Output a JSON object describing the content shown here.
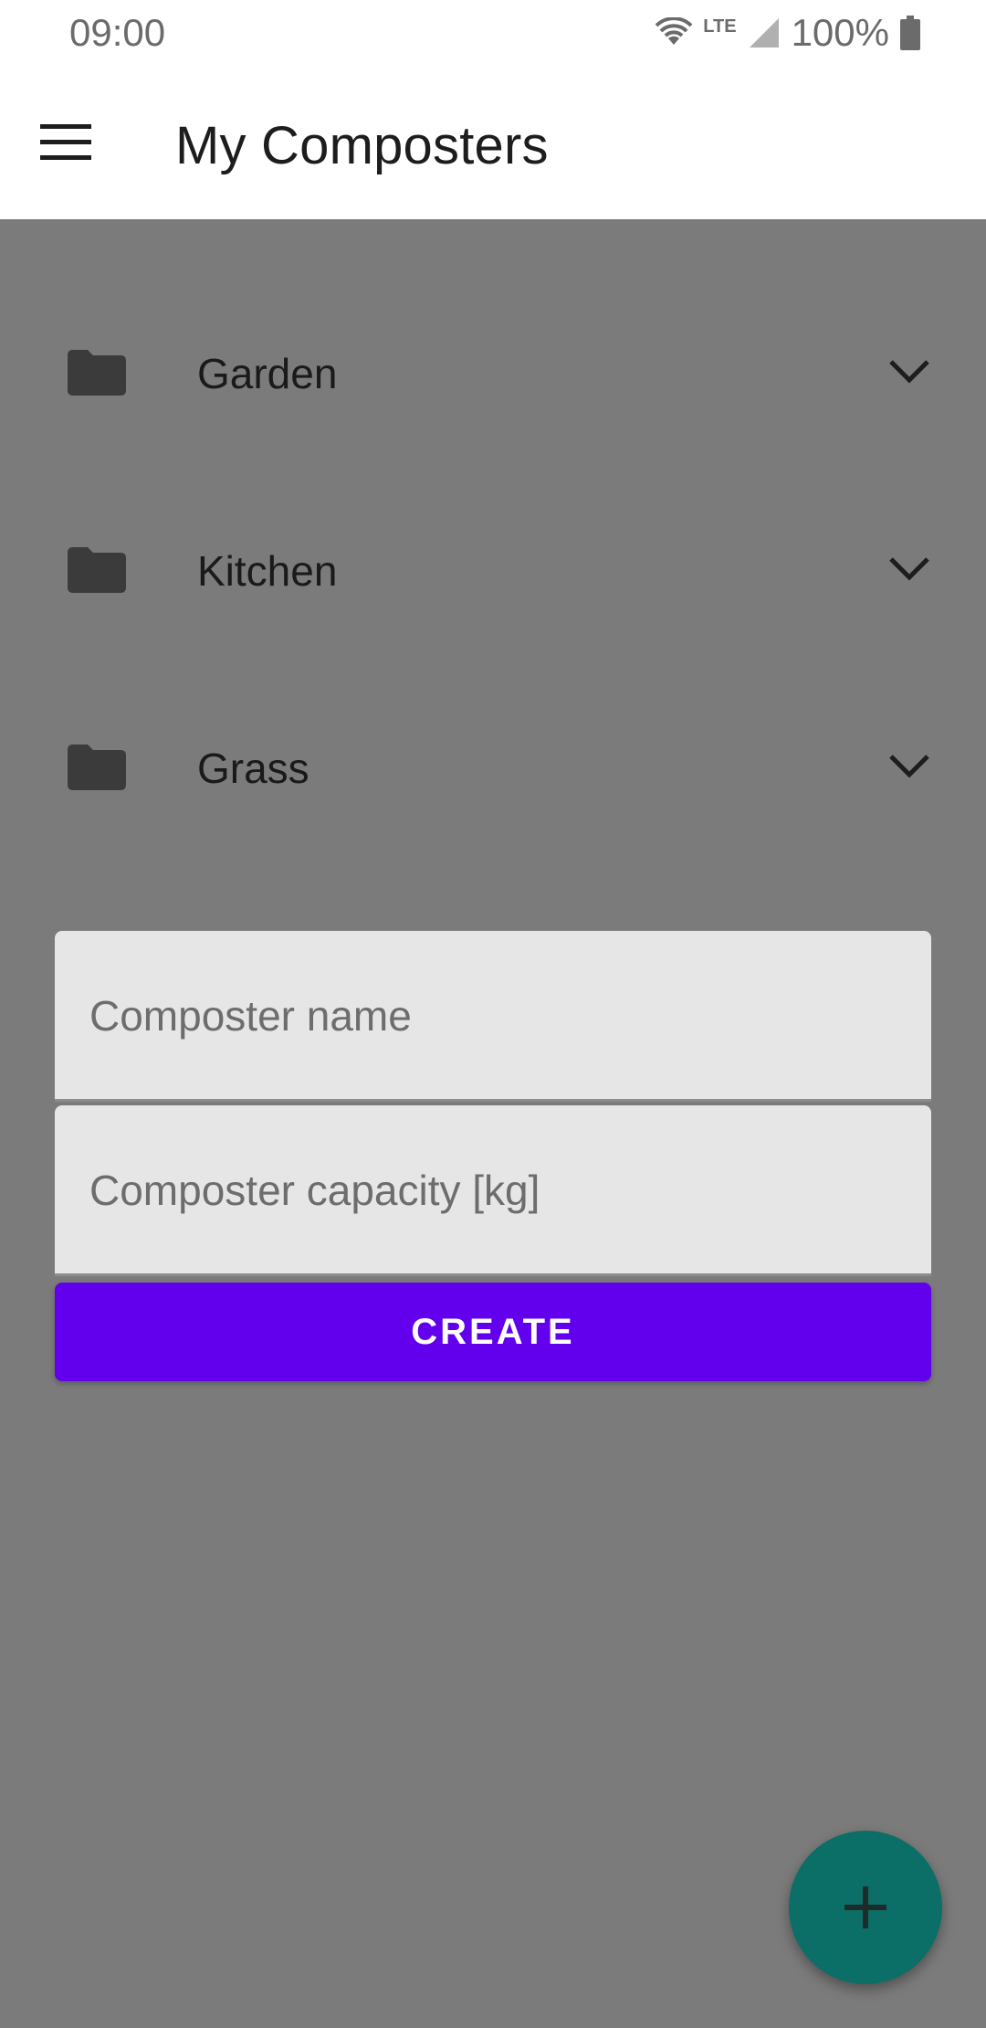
{
  "status_bar": {
    "time": "09:00",
    "network": "LTE",
    "battery": "100%",
    "icons": [
      "wifi-icon",
      "signal-icon",
      "battery-icon"
    ]
  },
  "app_bar": {
    "title": "My Composters",
    "menu_icon": "hamburger-menu-icon"
  },
  "composters": [
    {
      "name": "Garden",
      "icon": "folder-icon",
      "expand_icon": "chevron-down-icon"
    },
    {
      "name": "Kitchen",
      "icon": "folder-icon",
      "expand_icon": "chevron-down-icon"
    },
    {
      "name": "Grass",
      "icon": "folder-icon",
      "expand_icon": "chevron-down-icon"
    }
  ],
  "form": {
    "name_field": {
      "placeholder": "Composter name",
      "value": ""
    },
    "capacity_field": {
      "placeholder": "Composter capacity [kg]",
      "value": ""
    },
    "create_label": "CREATE"
  },
  "fab": {
    "icon": "plus-icon"
  },
  "colors": {
    "scrim": "#7b7b7b",
    "primary": "#6200ee",
    "fab": "#0b6e67"
  }
}
